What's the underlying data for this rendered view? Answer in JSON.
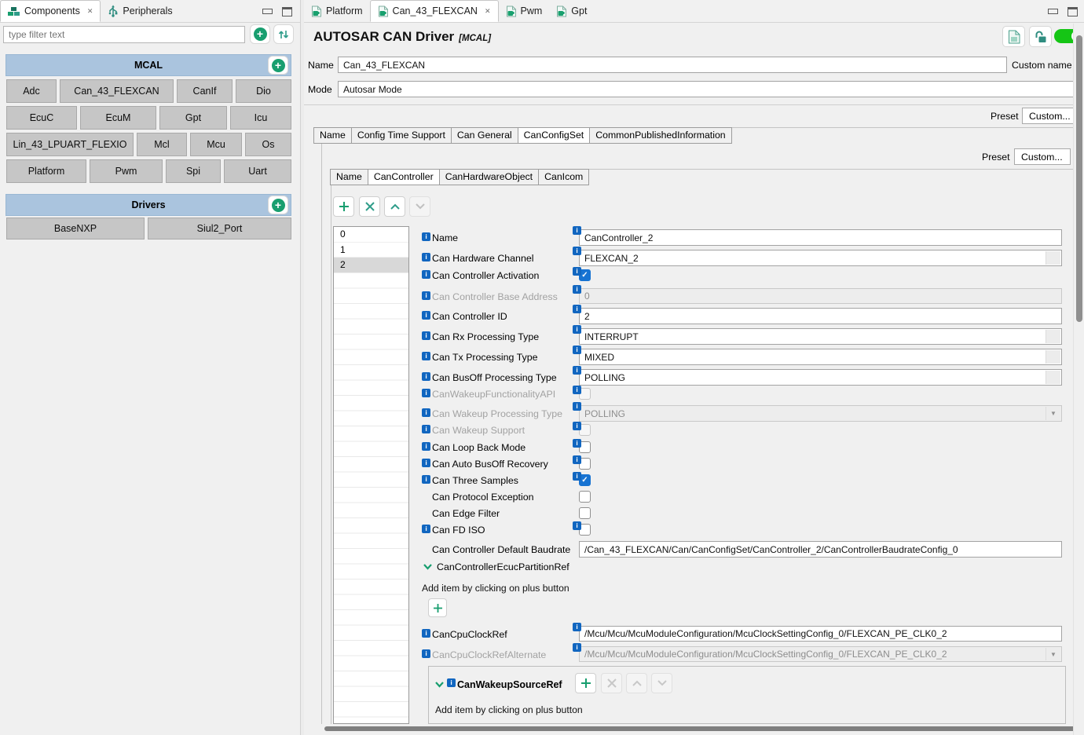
{
  "icons": {
    "close": "✕",
    "info": "i",
    "check": "✓",
    "dropdown_arrow": "▼"
  },
  "left_panel": {
    "tabs": {
      "components": "Components",
      "peripherals": "Peripherals"
    },
    "filter_placeholder": "type filter text",
    "mcal": {
      "title": "MCAL",
      "rows": [
        [
          "Adc",
          "Can_43_FLEXCAN",
          "CanIf",
          "Dio"
        ],
        [
          "EcuC",
          "EcuM",
          "Gpt",
          "Icu"
        ],
        [
          "Lin_43_LPUART_FLEXIO",
          "Mcl",
          "Mcu",
          "Os"
        ],
        [
          "Platform",
          "Pwm",
          "Spi",
          "Uart"
        ]
      ]
    },
    "drivers": {
      "title": "Drivers",
      "items": [
        "BaseNXP",
        "Siul2_Port"
      ]
    }
  },
  "editor": {
    "tabs": [
      "Platform",
      "Can_43_FLEXCAN",
      "Pwm",
      "Gpt"
    ],
    "active_tab": "Can_43_FLEXCAN",
    "title": "AUTOSAR CAN Driver",
    "title_tag": "[MCAL]",
    "name_label": "Name",
    "name_value": "Can_43_FLEXCAN",
    "custom_name_label": "Custom name",
    "mode_label": "Mode",
    "mode_value": "Autosar Mode",
    "preset_label": "Preset",
    "preset_value": "Custom...",
    "outer_tabs": [
      "Name",
      "Config Time Support",
      "Can General",
      "CanConfigSet",
      "CommonPublishedInformation"
    ],
    "outer_active": "CanConfigSet",
    "inner_tabs": [
      "Name",
      "CanController",
      "CanHardwareObject",
      "CanIcom"
    ],
    "inner_active": "CanController",
    "controller_list": [
      "0",
      "1",
      "2"
    ],
    "selected_controller": "2",
    "add_hint": "Add item by clicking on plus button",
    "fields": {
      "name": {
        "label": "Name",
        "value": "CanController_2"
      },
      "hw_channel": {
        "label": "Can Hardware Channel",
        "value": "FLEXCAN_2"
      },
      "activation": {
        "label": "Can Controller Activation",
        "checked": true
      },
      "base_address": {
        "label": "Can Controller Base Address",
        "value": "0",
        "disabled": true
      },
      "controller_id": {
        "label": "Can Controller ID",
        "value": "2"
      },
      "rx_type": {
        "label": "Can Rx Processing Type",
        "value": "INTERRUPT"
      },
      "tx_type": {
        "label": "Can Tx Processing Type",
        "value": "MIXED"
      },
      "busoff_type": {
        "label": "Can BusOff Processing Type",
        "value": "POLLING"
      },
      "wakeup_api": {
        "label": "CanWakeupFunctionalityAPI",
        "checked": false,
        "disabled": true
      },
      "wakeup_type": {
        "label": "Can Wakeup Processing Type",
        "value": "POLLING",
        "disabled": true
      },
      "wakeup_support": {
        "label": "Can Wakeup Support",
        "checked": false,
        "disabled": true
      },
      "loopback": {
        "label": "Can Loop Back Mode",
        "checked": false
      },
      "auto_busoff": {
        "label": "Can Auto BusOff Recovery",
        "checked": false
      },
      "three_samples": {
        "label": "Can Three Samples",
        "checked": true
      },
      "protocol_exception": {
        "label": "Can Protocol Exception",
        "checked": false
      },
      "edge_filter": {
        "label": "Can Edge Filter",
        "checked": false
      },
      "fd_iso": {
        "label": "Can FD ISO",
        "checked": false
      },
      "default_baudrate": {
        "label": "Can Controller Default Baudrate",
        "value": "/Can_43_FLEXCAN/Can/CanConfigSet/CanController_2/CanControllerBaudrateConfig_0"
      },
      "ecuc_partition_ref": {
        "label": "CanControllerEcucPartitionRef"
      },
      "cpu_clock_ref": {
        "label": "CanCpuClockRef",
        "value": "/Mcu/Mcu/McuModuleConfiguration/McuClockSettingConfig_0/FLEXCAN_PE_CLK0_2"
      },
      "cpu_clock_ref_alt": {
        "label": "CanCpuClockRefAlternate",
        "value": "/Mcu/Mcu/McuModuleConfiguration/McuClockSettingConfig_0/FLEXCAN_PE_CLK0_2",
        "disabled": true
      },
      "wakeup_source_ref": {
        "label": "CanWakeupSourceRef"
      }
    }
  }
}
